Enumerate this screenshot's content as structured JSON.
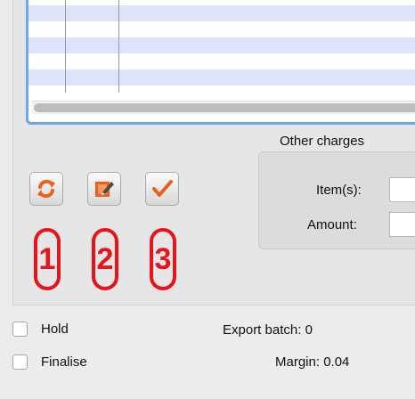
{
  "other_charges": {
    "title": "Other charges",
    "items_label": "Item(s):",
    "amount_label": "Amount:",
    "items_value": "",
    "amount_value": ""
  },
  "toolbar": {
    "buttons": [
      {
        "icon": "refresh-icon",
        "accent": "#e8611d"
      },
      {
        "icon": "edit-icon",
        "accent": "#e8611d"
      },
      {
        "icon": "checkmark-icon",
        "accent": "#e8611d"
      }
    ]
  },
  "annotations": {
    "labels": [
      "1",
      "2",
      "3"
    ],
    "color": "#e8141b"
  },
  "options": {
    "hold_label": "Hold",
    "finalise_label": "Finalise"
  },
  "summary": {
    "export_batch_label": "Export batch:",
    "export_batch_value": "0",
    "margin_label": "Margin:",
    "margin_value": "0.04"
  }
}
